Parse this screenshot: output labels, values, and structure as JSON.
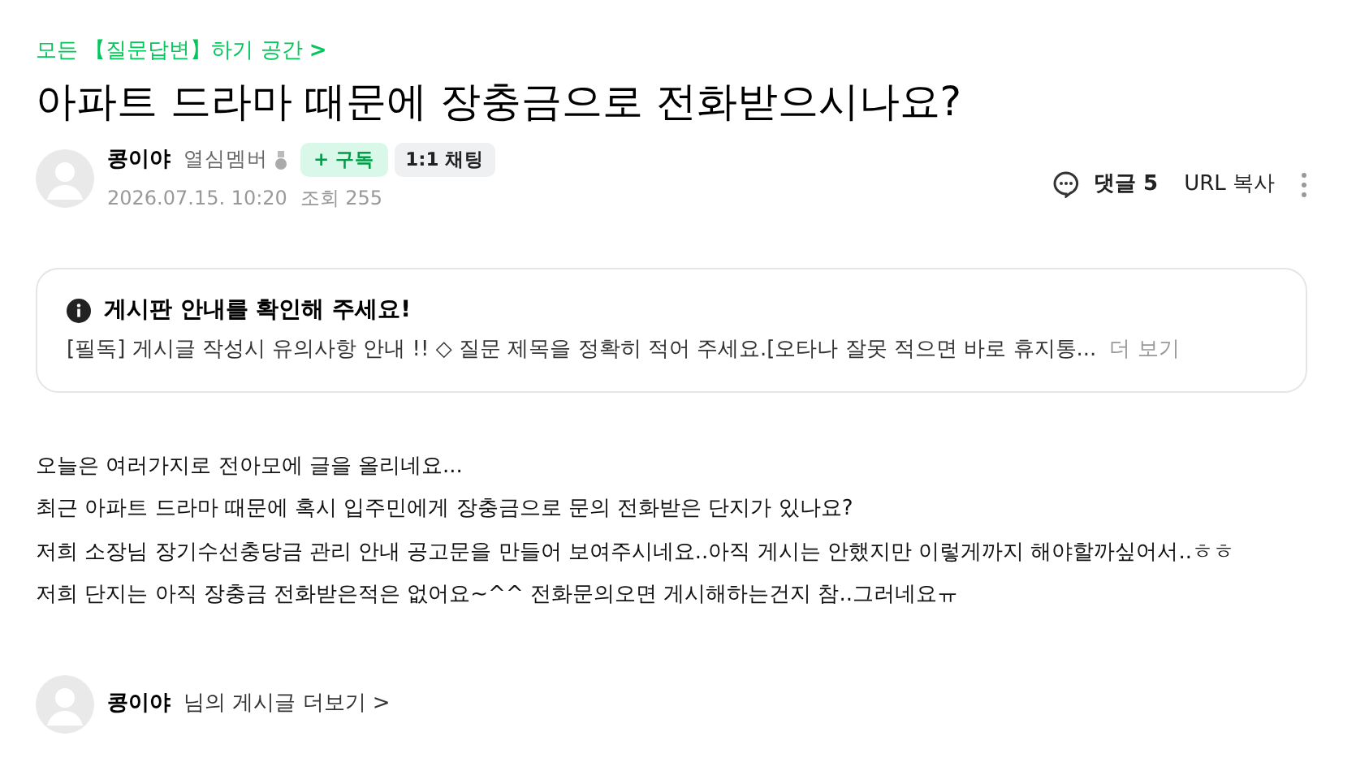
{
  "breadcrumb": {
    "label": "모든 【질문답변】하기 공간",
    "chevron": ">"
  },
  "title": "아파트 드라마 때문에 장충금으로 전화받으시나요?",
  "author": {
    "name": "콩이야",
    "level": "열심멤버",
    "subscribe": "+ 구독",
    "chat": "1:1 채팅",
    "date": "2026.07.15. 10:20",
    "views": "조회 255"
  },
  "actions": {
    "comments": "댓글 5",
    "copy_url": "URL 복사"
  },
  "notice": {
    "title": "게시판 안내를 확인해 주세요!",
    "text": "[필독] 게시글 작성시 유의사항 안내 !! ◇ 질문 제목을 정확히 적어 주세요.[오타나 잘못 적으면 바로 휴지통...",
    "more": "더 보기"
  },
  "body": [
    "오늘은 여러가지로 전아모에 글을 올리네요...",
    "최근 아파트 드라마 때문에 혹시 입주민에게 장충금으로 문의 전화받은 단지가 있나요?",
    "저희 소장님  장기수선충당금 관리 안내 공고문을 만들어 보여주시네요..아직 게시는 안했지만 이렇게까지 해야할까싶어서..ㅎㅎ",
    "저희 단지는 아직 장충금 전화받은적은 없어요~^^ 전화문의오면 게시해하는건지 참..그러네요ㅠ"
  ],
  "footer": {
    "name": "콩이야",
    "link": "님의 게시글 더보기",
    "chevron": ">"
  }
}
